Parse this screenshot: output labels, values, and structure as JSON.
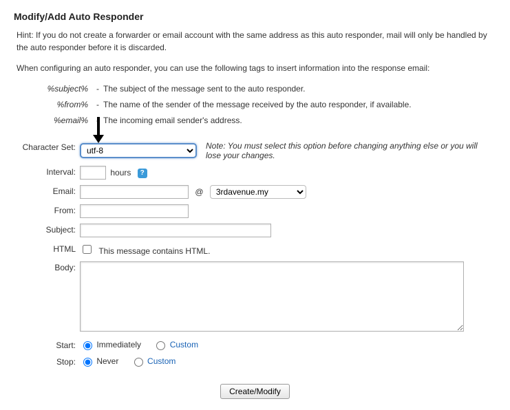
{
  "title": "Modify/Add Auto Responder",
  "hint": "Hint: If you do not create a forwarder or email account with the same address as this auto responder, mail will only be handled by the auto responder before it is discarded.",
  "info": "When configuring an auto responder, you can use the following tags to insert information into the response email:",
  "tags": [
    {
      "name": "%subject%",
      "desc": "The subject of the message sent to the auto responder."
    },
    {
      "name": "%from%",
      "desc": "The name of the sender of the message received by the auto responder, if available."
    },
    {
      "name": "%email%",
      "desc": "The incoming email sender's address."
    }
  ],
  "labels": {
    "charset": "Character Set:",
    "interval": "Interval:",
    "hours": "hours",
    "email": "Email:",
    "at": "@",
    "from": "From:",
    "subject": "Subject:",
    "html": "HTML",
    "html_desc": "This message contains HTML.",
    "body": "Body:",
    "start": "Start:",
    "stop": "Stop:"
  },
  "charset_value": "utf-8",
  "charset_note": "Note: You must select this option before changing anything else or you will lose your changes.",
  "domain_value": "3rdavenue.my",
  "help_icon_title": "help",
  "start_options": {
    "immediate": "Immediately",
    "custom": "Custom"
  },
  "stop_options": {
    "never": "Never",
    "custom": "Custom"
  },
  "submit": "Create/Modify"
}
